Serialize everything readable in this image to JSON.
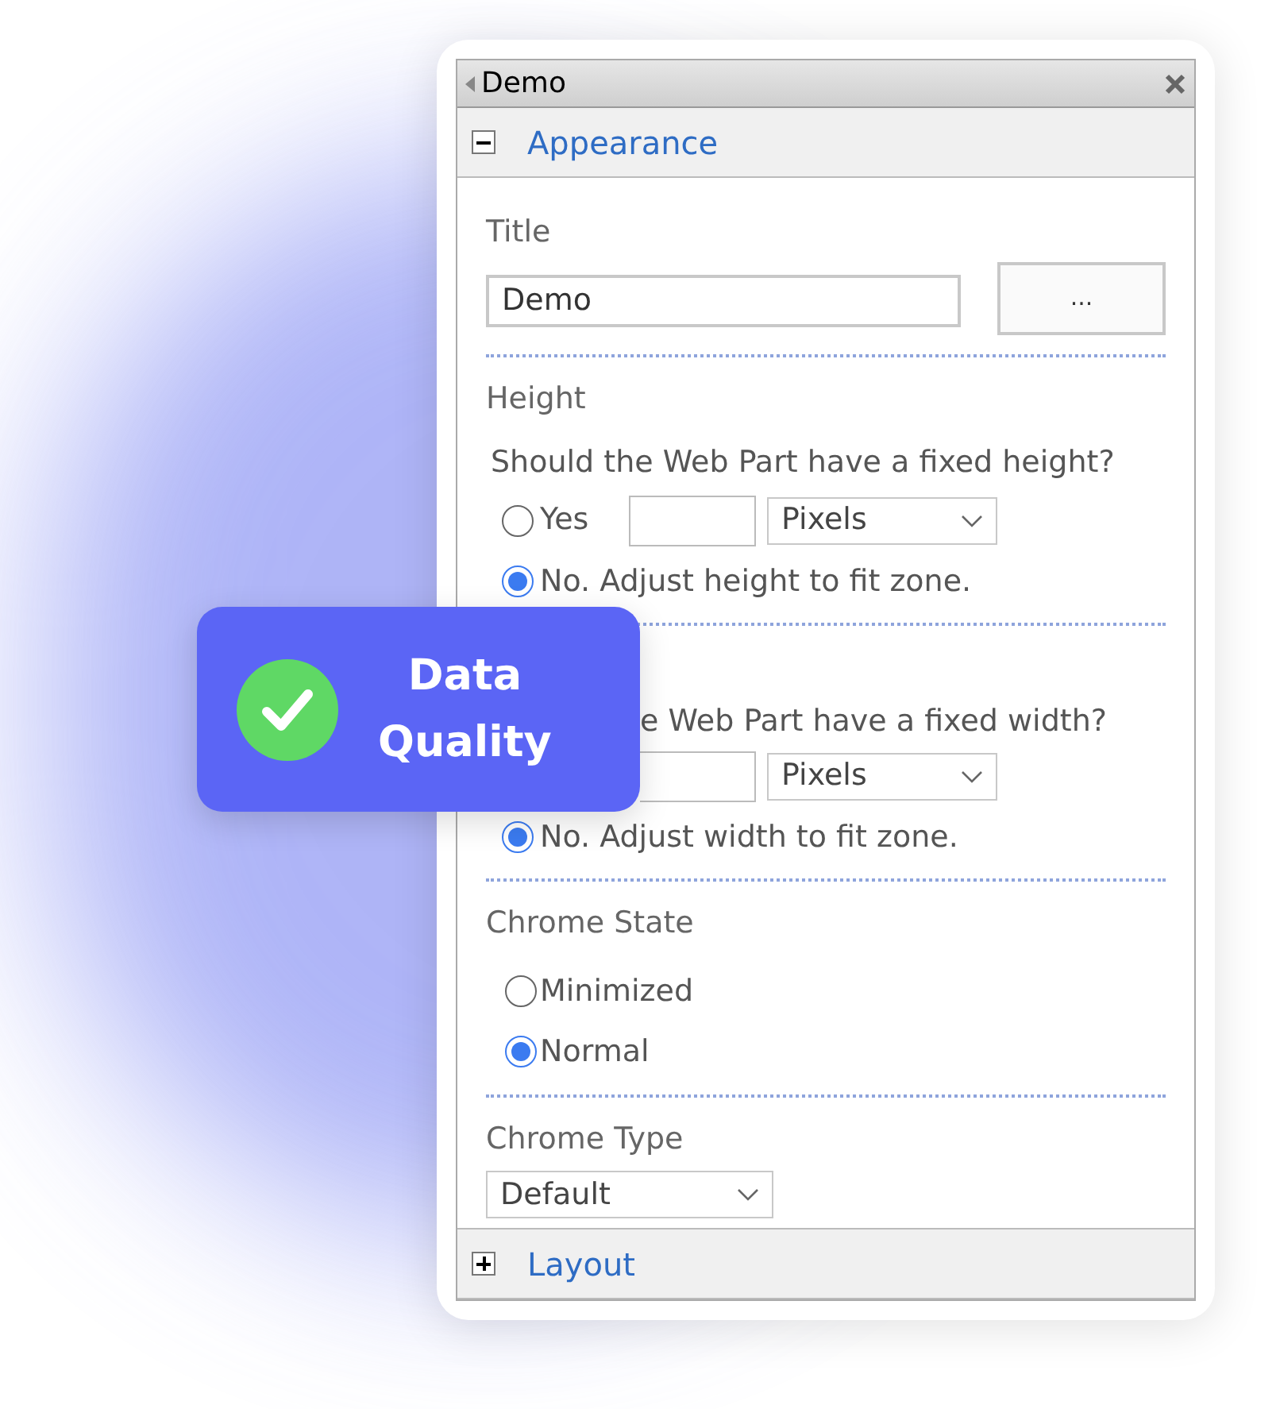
{
  "panel": {
    "title": "Demo",
    "sections": [
      {
        "title": "Appearance",
        "expanded": true
      },
      {
        "title": "Layout",
        "expanded": false
      }
    ],
    "title_field": {
      "label": "Title",
      "value": "Demo",
      "button": "..."
    },
    "height": {
      "label": "Height",
      "question": "Should the Web Part have a fixed height?",
      "fixed_label": "Yes",
      "fixed_selected": false,
      "unit": "Pixels",
      "auto_label": "No. Adjust height to fit zone.",
      "auto_selected": true
    },
    "width": {
      "question": "e Web Part have a fixed width?",
      "unit": "Pixels",
      "auto_label": "No. Adjust width to fit zone.",
      "auto_selected": true
    },
    "chrome_state": {
      "label": "Chrome State",
      "options": [
        {
          "label": "Minimized",
          "selected": false
        },
        {
          "label": "Normal",
          "selected": true
        }
      ]
    },
    "chrome_type": {
      "label": "Chrome Type",
      "value": "Default"
    }
  },
  "badge": {
    "lines": [
      "Data",
      "Quality"
    ]
  }
}
